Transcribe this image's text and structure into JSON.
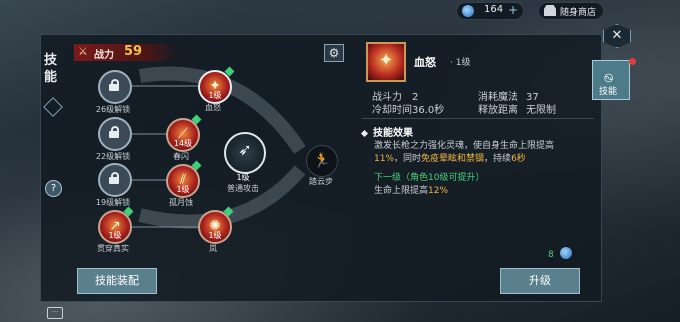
{
  "topbar": {
    "currency_value": "164",
    "currency_plus": "+",
    "shop_label": "随身商店"
  },
  "sidebar": {
    "title": "技能",
    "help": "?"
  },
  "power": {
    "label": "战力",
    "value": "59"
  },
  "skill_tree": {
    "locked": [
      {
        "label": "26级解锁"
      },
      {
        "label": "22级解锁"
      },
      {
        "label": "19级解锁"
      }
    ],
    "skills": [
      {
        "level": "1级",
        "name": "血怒"
      },
      {
        "level": "14级",
        "name": "春闪"
      },
      {
        "level": "1级",
        "name": "孤月蚀"
      },
      {
        "level": "1级",
        "name": "贯穿真实"
      },
      {
        "level": "1级",
        "name": "岚"
      }
    ],
    "main": {
      "level": "1级",
      "name": "普通攻击"
    },
    "dodge": {
      "name": "踏云步"
    }
  },
  "buttons": {
    "equip": "技能装配",
    "upgrade": "升级"
  },
  "detail": {
    "name": "血怒",
    "level": "· 1级",
    "stats": [
      {
        "key": "战斗力",
        "value": "2"
      },
      {
        "key": "消耗魔法",
        "value": "37"
      },
      {
        "key": "冷却时间",
        "value": "36.0秒"
      },
      {
        "key": "释放距离",
        "value": "无限制"
      }
    ],
    "effect_header": "技能效果",
    "desc_a": "激发长枪之力强化灵魂，使自身生命上限提高",
    "desc_b": "11%",
    "desc_c": "，同时",
    "desc_d": "免疫晕眩和禁锢",
    "desc_e": "，持续",
    "desc_f": "6秒",
    "next_label": "下一级（角色10级可提升）",
    "next_a": "生命上限提高",
    "next_b": "12%",
    "cost": "8"
  },
  "tabs": {
    "skill": "技能",
    "close": "✕"
  },
  "icons": {
    "chat": "···"
  }
}
